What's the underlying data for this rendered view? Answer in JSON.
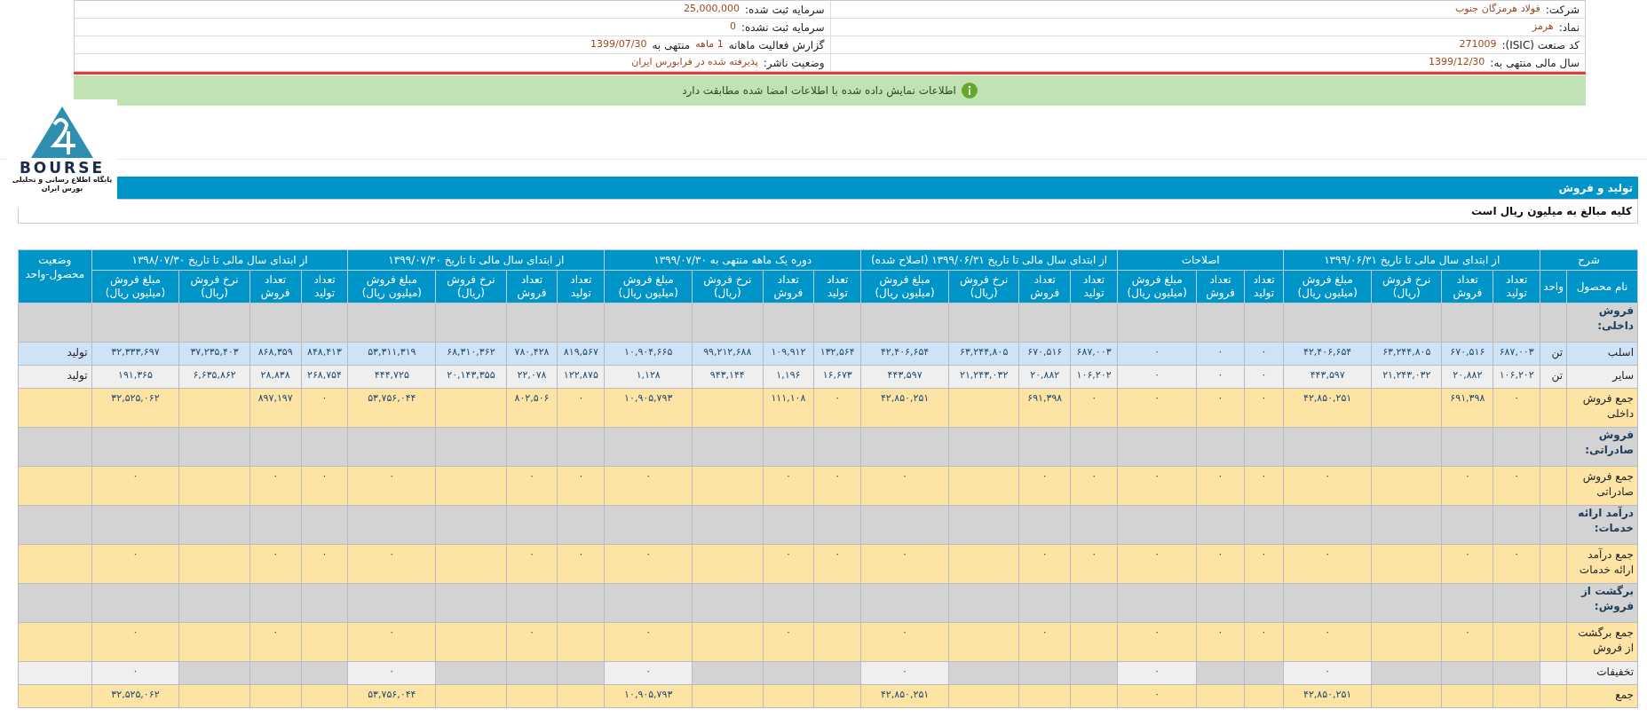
{
  "company_info": {
    "rows": [
      {
        "right": [
          {
            "kind": "label",
            "text": "شرکت:"
          },
          {
            "kind": "value",
            "text": "فولاد هرمزگان جنوب"
          }
        ],
        "left": [
          {
            "kind": "label",
            "text": "سرمایه ثبت شده:"
          },
          {
            "kind": "value",
            "text": "25,000,000"
          }
        ]
      },
      {
        "right": [
          {
            "kind": "label",
            "text": "نماد:"
          },
          {
            "kind": "value",
            "text": "هرمز"
          }
        ],
        "left": [
          {
            "kind": "label",
            "text": "سرمایه ثبت نشده:"
          },
          {
            "kind": "value",
            "text": "0"
          }
        ]
      },
      {
        "right": [
          {
            "kind": "label",
            "text": "کد صنعت (ISIC):"
          },
          {
            "kind": "value",
            "text": "271009"
          }
        ],
        "left": [
          {
            "kind": "label",
            "text": "گزارش فعالیت ماهانه"
          },
          {
            "kind": "value",
            "text": "1 ماهه"
          },
          {
            "kind": "label",
            "text": "منتهی به"
          },
          {
            "kind": "value",
            "text": "1399/07/30"
          }
        ]
      },
      {
        "right": [
          {
            "kind": "label",
            "text": "سال مالی منتهی به:"
          },
          {
            "kind": "value",
            "text": "1399/12/30"
          }
        ],
        "left": [
          {
            "kind": "label",
            "text": "وضعیت ناشر:"
          },
          {
            "kind": "value",
            "text": "پذیرفته شده در فرابورس ایران"
          }
        ]
      }
    ]
  },
  "alert": {
    "kind": "info",
    "text": "اطلاعات نمایش داده شده با اطلاعات امضا شده مطابقت دارد"
  },
  "logo": {
    "wordmark": "BOURSE",
    "tagline": "پایگاه اطلاع رسانی و تحلیلی بورس ایران"
  },
  "section": {
    "title": "تولید و فروش",
    "note": "کلیه مبالغ به میلیون ریال است"
  },
  "table": {
    "groups": [
      {
        "label": "شرح",
        "columns": [
          {
            "label": "نام محصول",
            "kind": "label"
          },
          {
            "label": "واحد",
            "kind": "label"
          }
        ]
      },
      {
        "label": "از ابتدای سال مالی تا تاریخ ۱۳۹۹/۰۶/۳۱",
        "columns": [
          {
            "label": "تعداد تولید",
            "kind": "quantity"
          },
          {
            "label": "تعداد فروش",
            "kind": "quantity"
          },
          {
            "label": "نرخ فروش (ریال)",
            "kind": "rate"
          },
          {
            "label": "مبلغ فروش (میلیون ریال)",
            "kind": "amount"
          }
        ]
      },
      {
        "label": "اصلاحات",
        "columns": [
          {
            "label": "تعداد تولید",
            "kind": "quantity"
          },
          {
            "label": "تعداد فروش",
            "kind": "quantity"
          },
          {
            "label": "مبلغ فروش (میلیون ریال)",
            "kind": "amount"
          }
        ]
      },
      {
        "label": "از ابتدای سال مالی تا تاریخ ۱۳۹۹/۰۶/۳۱ (اصلاح شده)",
        "columns": [
          {
            "label": "تعداد تولید",
            "kind": "quantity"
          },
          {
            "label": "تعداد فروش",
            "kind": "quantity"
          },
          {
            "label": "نرخ فروش (ریال)",
            "kind": "rate"
          },
          {
            "label": "مبلغ فروش (میلیون ریال)",
            "kind": "amount"
          }
        ]
      },
      {
        "label": "دوره یک ماهه منتهی به ۱۳۹۹/۰۷/۳۰",
        "columns": [
          {
            "label": "تعداد تولید",
            "kind": "quantity"
          },
          {
            "label": "تعداد فروش",
            "kind": "quantity"
          },
          {
            "label": "نرخ فروش (ریال)",
            "kind": "rate"
          },
          {
            "label": "مبلغ فروش (میلیون ریال)",
            "kind": "amount"
          }
        ]
      },
      {
        "label": "از ابتدای سال مالی تا تاریخ ۱۳۹۹/۰۷/۳۰",
        "columns": [
          {
            "label": "تعداد تولید",
            "kind": "quantity"
          },
          {
            "label": "تعداد فروش",
            "kind": "quantity"
          },
          {
            "label": "نرخ فروش (ریال)",
            "kind": "rate"
          },
          {
            "label": "مبلغ فروش (میلیون ریال)",
            "kind": "amount"
          }
        ]
      },
      {
        "label": "از ابتدای سال مالی تا تاریخ ۱۳۹۸/۰۷/۳۰",
        "columns": [
          {
            "label": "تعداد تولید",
            "kind": "quantity"
          },
          {
            "label": "تعداد فروش",
            "kind": "quantity"
          },
          {
            "label": "نرخ فروش (ریال)",
            "kind": "rate"
          },
          {
            "label": "مبلغ فروش (میلیون ریال)",
            "kind": "amount"
          }
        ]
      },
      {
        "label": "وضعیت محصول-واحد"
      }
    ],
    "rows": [
      {
        "kind": "section",
        "label": "فروش داخلی:"
      },
      {
        "kind": "item",
        "selected": true,
        "cells": [
          "اسلب",
          "تن",
          "۶۸۷,۰۰۳",
          "۶۷۰,۵۱۶",
          "۶۳,۲۴۴,۸۰۵",
          "۴۲,۴۰۶,۶۵۴",
          "۰",
          "۰",
          "۰",
          "۶۸۷,۰۰۳",
          "۶۷۰,۵۱۶",
          "۶۳,۲۴۴,۸۰۵",
          "۴۲,۴۰۶,۶۵۴",
          "۱۳۲,۵۶۴",
          "۱۰۹,۹۱۲",
          "۹۹,۲۱۲,۶۸۸",
          "۱۰,۹۰۴,۶۶۵",
          "۸۱۹,۵۶۷",
          "۷۸۰,۴۲۸",
          "۶۸,۳۱۰,۳۶۲",
          "۵۳,۳۱۱,۳۱۹",
          "۸۴۸,۴۱۳",
          "۸۶۸,۳۵۹",
          "۳۷,۲۳۵,۴۰۳",
          "۳۲,۳۳۳,۶۹۷",
          "تولید"
        ]
      },
      {
        "kind": "item",
        "selected": false,
        "cells": [
          "سایر",
          "تن",
          "۱۰۶,۲۰۲",
          "۲۰,۸۸۲",
          "۲۱,۲۴۳,۰۳۲",
          "۴۴۳,۵۹۷",
          "۰",
          "۰",
          "۰",
          "۱۰۶,۲۰۲",
          "۲۰,۸۸۲",
          "۲۱,۲۴۳,۰۳۲",
          "۴۴۳,۵۹۷",
          "۱۶,۶۷۳",
          "۱,۱۹۶",
          "۹۴۳,۱۴۴",
          "۱,۱۲۸",
          "۱۲۲,۸۷۵",
          "۲۲,۰۷۸",
          "۲۰,۱۴۳,۳۵۵",
          "۴۴۴,۷۲۵",
          "۲۶۸,۷۵۴",
          "۲۸,۸۳۸",
          "۶,۶۳۵,۸۶۲",
          "۱۹۱,۳۶۵",
          "تولید"
        ]
      },
      {
        "kind": "total",
        "cells": [
          "جمع فروش داخلی",
          null,
          "۰",
          "۶۹۱,۳۹۸",
          null,
          "۴۲,۸۵۰,۲۵۱",
          "۰",
          "۰",
          "۰",
          "۰",
          "۶۹۱,۳۹۸",
          null,
          "۴۲,۸۵۰,۲۵۱",
          "۰",
          "۱۱۱,۱۰۸",
          null,
          "۱۰,۹۰۵,۷۹۳",
          "۰",
          "۸۰۲,۵۰۶",
          null,
          "۵۳,۷۵۶,۰۴۴",
          "۰",
          "۸۹۷,۱۹۷",
          null,
          "۳۲,۵۲۵,۰۶۲",
          null
        ]
      },
      {
        "kind": "section",
        "label": "فروش صادراتی:"
      },
      {
        "kind": "total",
        "cells": [
          "جمع فروش صادراتی",
          null,
          "۰",
          "۰",
          null,
          "۰",
          "۰",
          "۰",
          "۰",
          "۰",
          "۰",
          null,
          "۰",
          "۰",
          "۰",
          null,
          "۰",
          "۰",
          "۰",
          null,
          "۰",
          "۰",
          "۰",
          null,
          "۰",
          null
        ]
      },
      {
        "kind": "section",
        "label": "درآمد ارائه خدمات:"
      },
      {
        "kind": "total",
        "cells": [
          "جمع درآمد ارائه خدمات",
          null,
          "۰",
          "۰",
          null,
          "۰",
          "۰",
          "۰",
          "۰",
          "۰",
          "۰",
          null,
          "۰",
          "۰",
          "۰",
          null,
          "۰",
          "۰",
          "۰",
          null,
          "۰",
          "۰",
          "۰",
          null,
          "۰",
          null
        ]
      },
      {
        "kind": "section",
        "label": "برگشت از فروش:"
      },
      {
        "kind": "total",
        "cells": [
          "جمع برگشت از فروش",
          null,
          null,
          "۰",
          null,
          "۰",
          "۰",
          "۰",
          "۰",
          null,
          "۰",
          null,
          "۰",
          null,
          "۰",
          null,
          "۰",
          null,
          "۰",
          null,
          "۰",
          null,
          "۰",
          null,
          "۰",
          null
        ]
      },
      {
        "kind": "discount",
        "cells": [
          "تخفیفات",
          null,
          null,
          null,
          null,
          "۰",
          null,
          null,
          "۰",
          null,
          null,
          null,
          "۰",
          null,
          null,
          null,
          "۰",
          null,
          null,
          null,
          "۰",
          null,
          null,
          null,
          "۰",
          null
        ]
      },
      {
        "kind": "total",
        "cells": [
          "جمع",
          null,
          null,
          null,
          null,
          "۴۲,۸۵۰,۲۵۱",
          null,
          null,
          "۰",
          null,
          null,
          null,
          "۴۲,۸۵۰,۲۵۱",
          null,
          null,
          null,
          "۱۰,۹۰۵,۷۹۳",
          null,
          null,
          null,
          "۵۳,۷۵۶,۰۴۴",
          null,
          null,
          null,
          "۳۲,۵۲۵,۰۶۲",
          null
        ]
      }
    ]
  }
}
